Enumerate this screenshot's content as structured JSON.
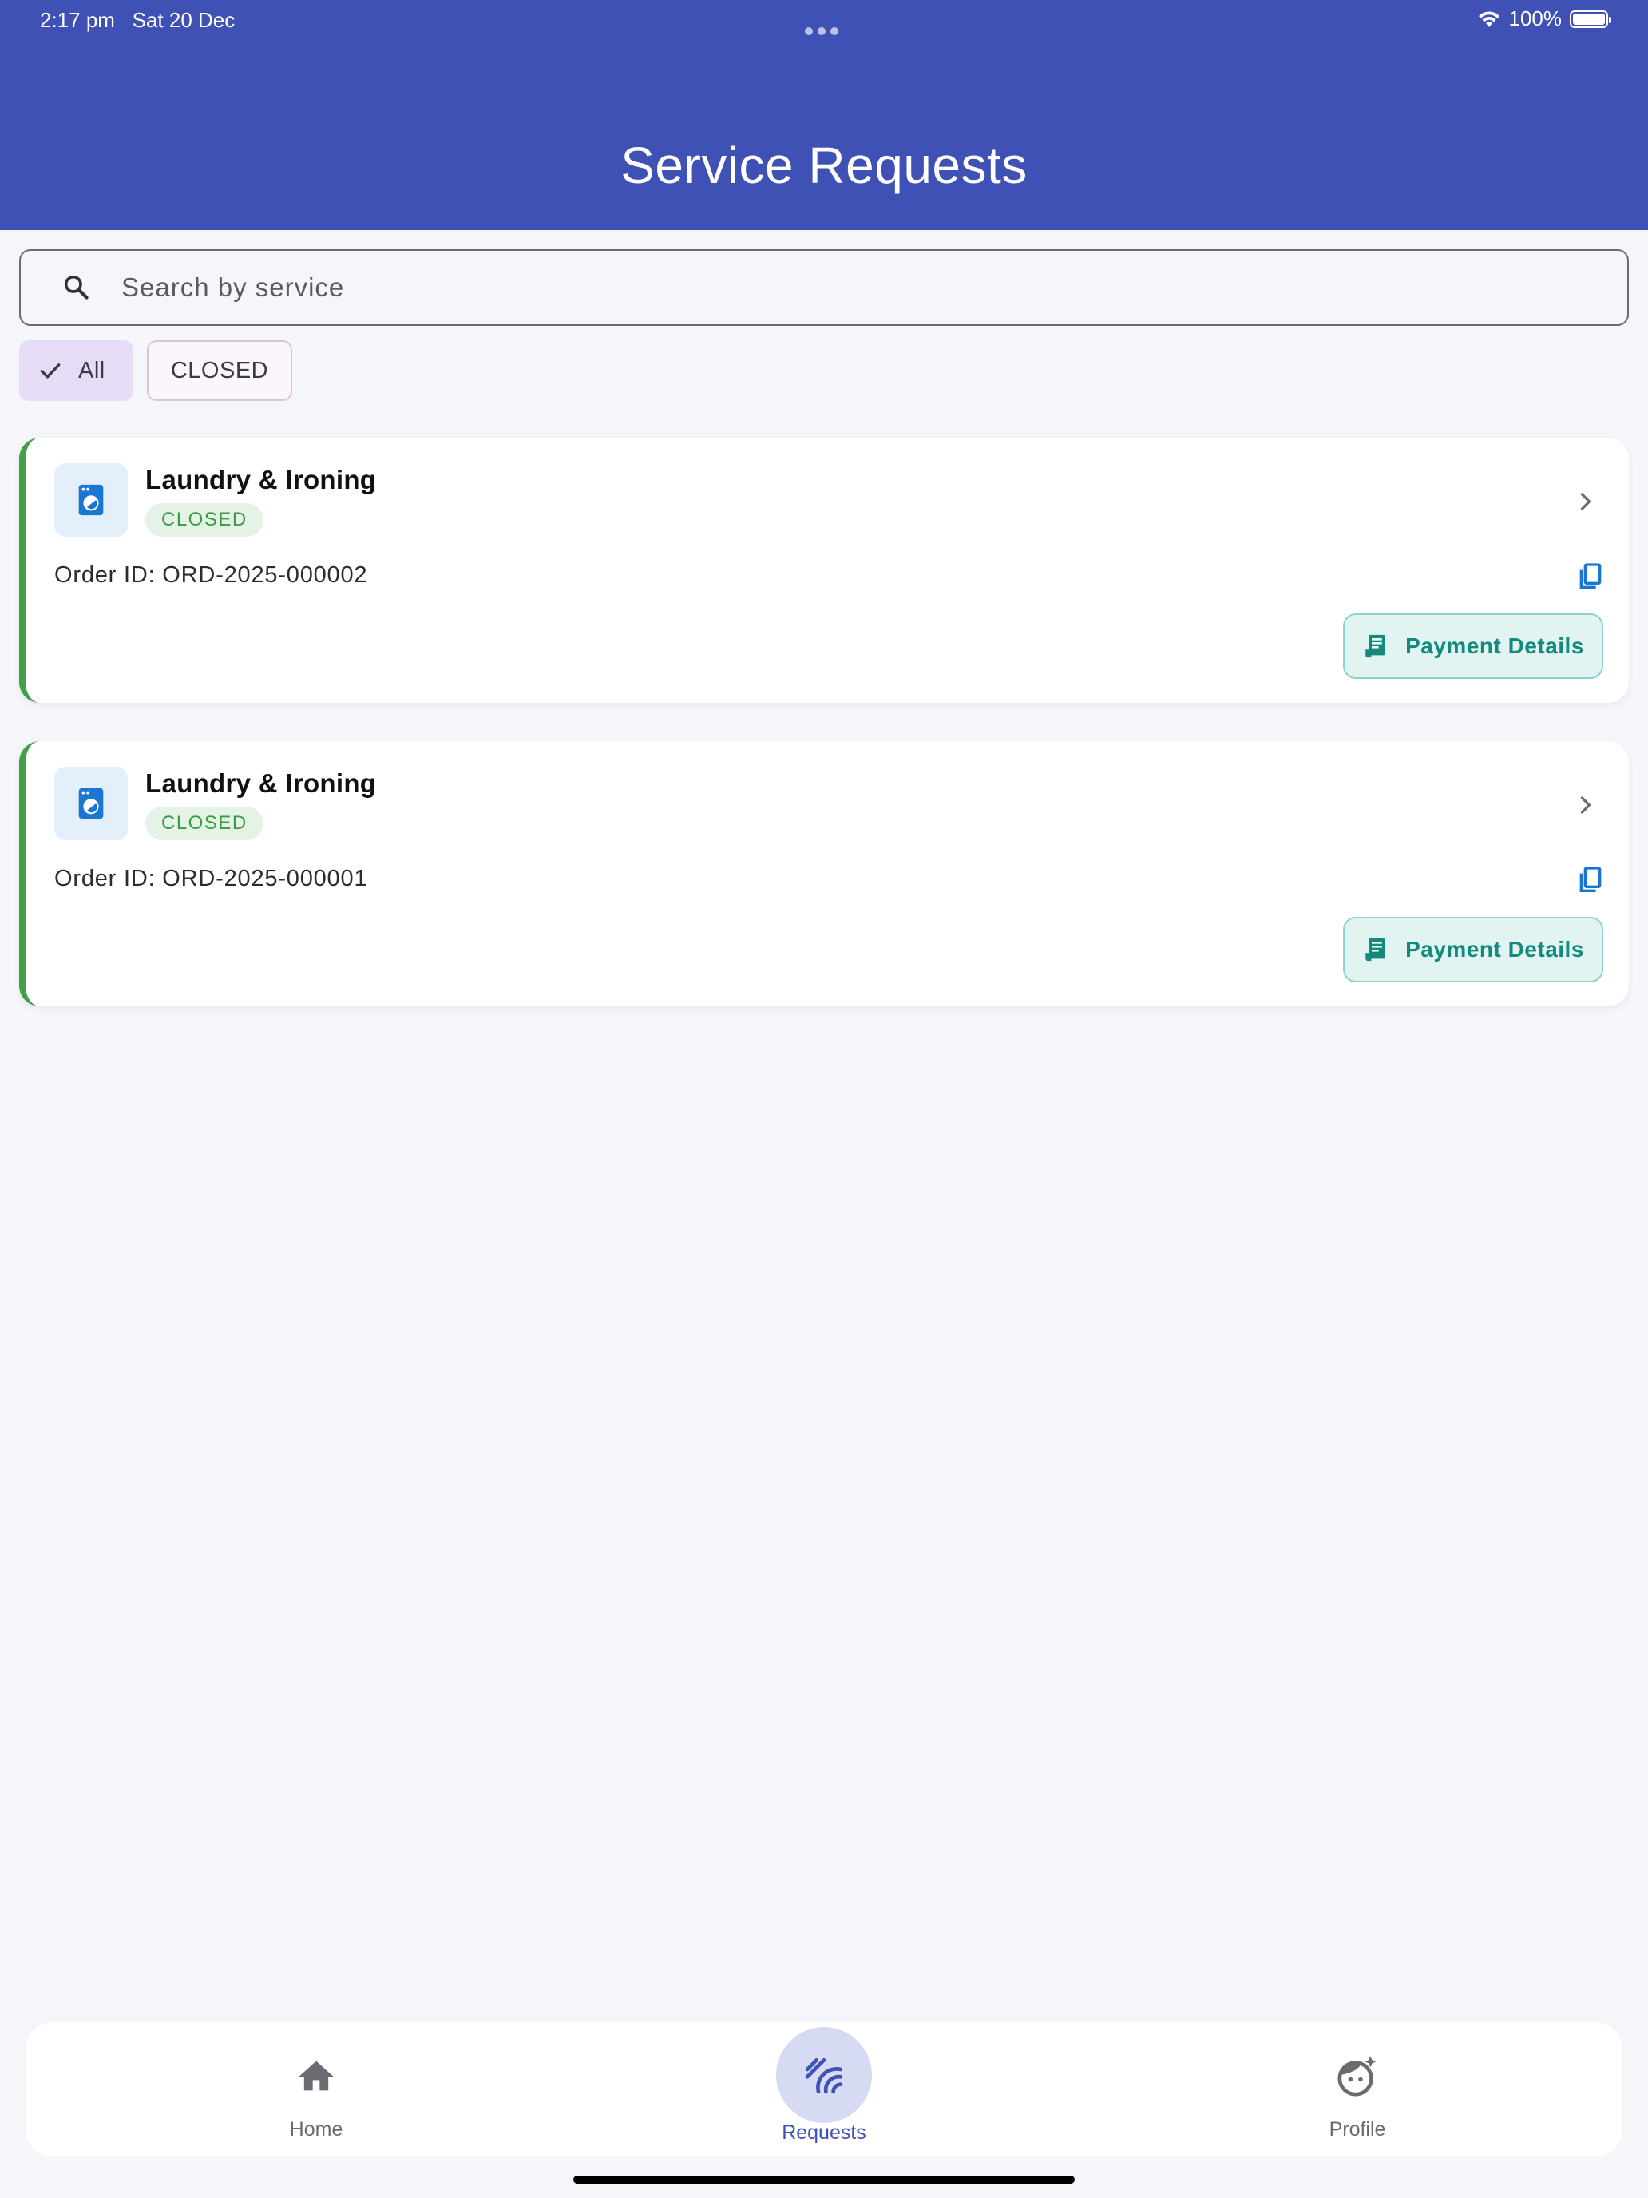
{
  "status_bar": {
    "time": "2:17 pm",
    "date": "Sat 20 Dec",
    "battery": "100%"
  },
  "header": {
    "title": "Service Requests",
    "color": "#3f51b5"
  },
  "search": {
    "placeholder": "Search by service",
    "value": ""
  },
  "filters": {
    "all_label": "All",
    "closed_label": "CLOSED",
    "selected": "All"
  },
  "requests": [
    {
      "service": "Laundry & Ironing",
      "status": "CLOSED",
      "order_id": "Order ID: ORD-2025-000002",
      "action_label": "Payment Details",
      "icon": "washing-machine-icon"
    },
    {
      "service": "Laundry & Ironing",
      "status": "CLOSED",
      "order_id": "Order ID: ORD-2025-000001",
      "action_label": "Payment Details",
      "icon": "washing-machine-icon"
    }
  ],
  "nav": {
    "home": "Home",
    "requests": "Requests",
    "profile": "Profile",
    "active": "Requests"
  },
  "colors": {
    "accent": "#3f51b5",
    "status_closed": "#43a047",
    "payment": "#138a7e"
  }
}
